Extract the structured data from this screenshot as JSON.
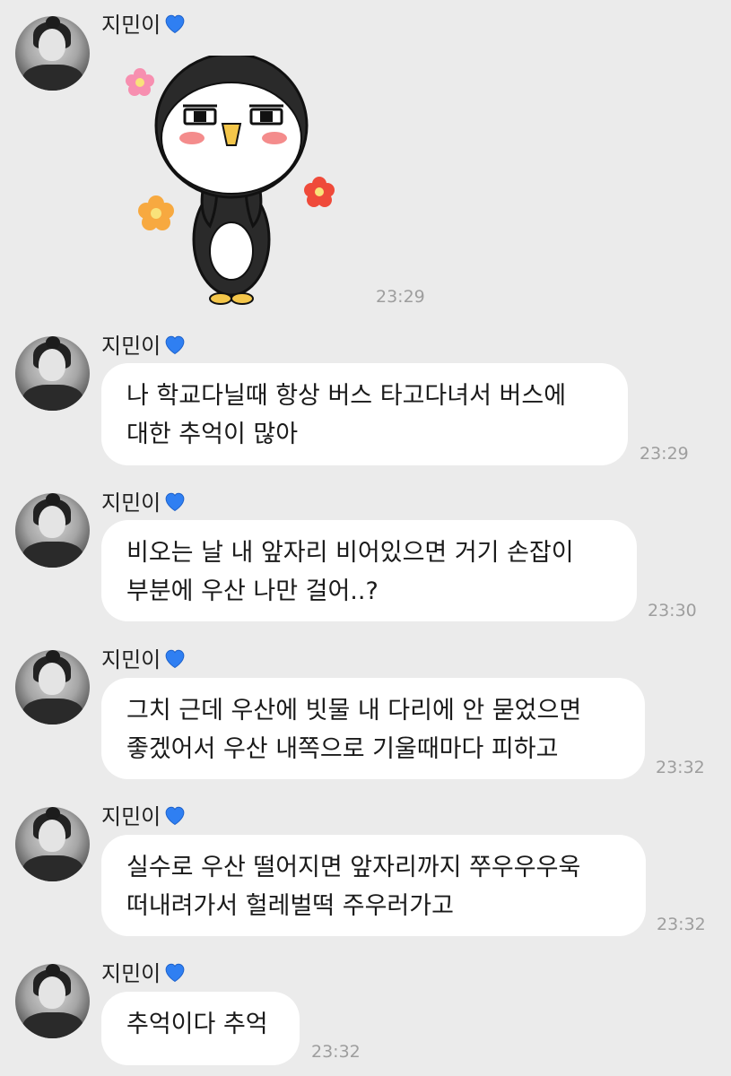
{
  "messages": [
    {
      "sender": "지민이",
      "type": "sticker",
      "sticker": "penguin-sticker",
      "time": "23:29"
    },
    {
      "sender": "지민이",
      "type": "text",
      "lines": [
        "나 학교다닐때 항상 버스 타고다녀서 버스에",
        "대한 추억이 많아"
      ],
      "time": "23:29"
    },
    {
      "sender": "지민이",
      "type": "text",
      "lines": [
        "비오는 날 내 앞자리 비어있으면 거기 손잡이",
        "부분에 우산 나만 걸어..?"
      ],
      "time": "23:30"
    },
    {
      "sender": "지민이",
      "type": "text",
      "lines": [
        "그치 근데 우산에 빗물 내 다리에 안 묻었으면",
        "좋겠어서 우산 내쪽으로 기울때마다 피하고"
      ],
      "time": "23:32"
    },
    {
      "sender": "지민이",
      "type": "text",
      "lines": [
        "실수로 우산 떨어지면 앞자리까지 쭈우우우욱",
        "떠내려가서 헐레벌떡 주우러가고"
      ],
      "time": "23:32"
    },
    {
      "sender": "지민이",
      "type": "text",
      "lines": [
        "추억이다 추억"
      ],
      "time": "23:32"
    }
  ],
  "colors": {
    "background": "#ebebeb",
    "bubble": "#ffffff",
    "heart": "#2f7ff2",
    "time": "#9e9e9e"
  },
  "icons": {
    "heart": "blue-heart-icon",
    "avatar": "profile-photo"
  }
}
